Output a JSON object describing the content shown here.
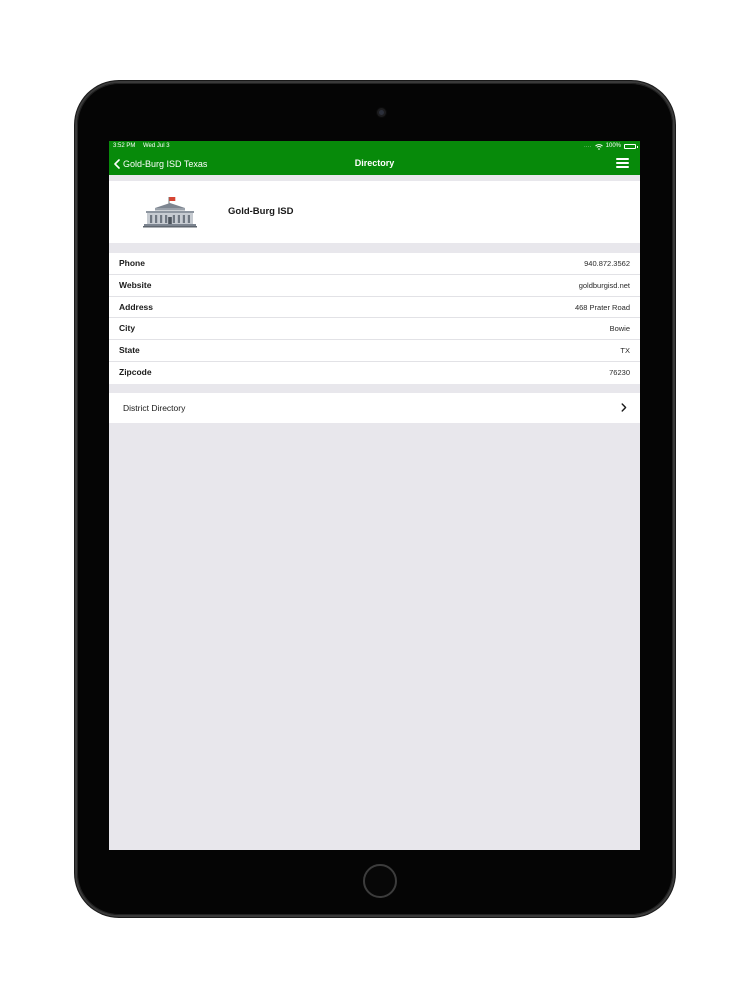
{
  "status_bar": {
    "time": "3:52 PM",
    "date": "Wed Jul 3",
    "signal_dots": "....",
    "battery": "100%"
  },
  "nav": {
    "back_label": "Gold-Burg ISD Texas",
    "title": "Directory"
  },
  "district": {
    "name": "Gold-Burg ISD"
  },
  "info_rows": [
    {
      "label": "Phone",
      "value": "940.872.3562"
    },
    {
      "label": "Website",
      "value": "goldburgisd.net"
    },
    {
      "label": "Address",
      "value": "468 Prater Road"
    },
    {
      "label": "City",
      "value": "Bowie"
    },
    {
      "label": "State",
      "value": "TX"
    },
    {
      "label": "Zipcode",
      "value": "76230"
    }
  ],
  "links": {
    "district_directory": "District Directory"
  },
  "icons": {
    "back": "chevron-left-icon",
    "menu": "hamburger-menu-icon",
    "building": "school-building-icon",
    "disclosure": "chevron-right-icon",
    "wifi": "wifi-icon",
    "battery": "battery-icon"
  },
  "colors": {
    "nav_green": "#078a0a",
    "screen_bg": "#e8e7ec",
    "device_black": "#050505",
    "flag_red": "#d64533"
  }
}
